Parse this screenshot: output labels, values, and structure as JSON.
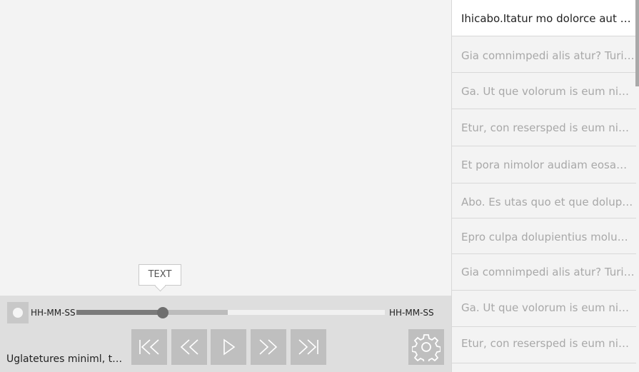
{
  "player": {
    "tooltip": "TEXT",
    "time_start": "HH-MM-SS",
    "time_end": "HH-MM-SS",
    "progress": {
      "played": 0.28,
      "buffered": 0.49
    },
    "caption": "Uglatetures miniml, tempo"
  },
  "controls": [
    {
      "name": "skip-to-start",
      "icon": "skip-start-icon"
    },
    {
      "name": "rewind",
      "icon": "rewind-icon"
    },
    {
      "name": "play",
      "icon": "play-icon"
    },
    {
      "name": "fast-forward",
      "icon": "fast-forward-icon"
    },
    {
      "name": "skip-to-end",
      "icon": "skip-end-icon"
    }
  ],
  "settings": {
    "icon": "gear-icon"
  },
  "playlist": {
    "items": [
      {
        "label": "Ihicabo.Itatur mo dolorce aut quam",
        "active": true
      },
      {
        "label": "Gia comnimpedi alis atur? Turibus",
        "active": false
      },
      {
        "label": "Ga. Ut que volorum is eum niatus",
        "active": false
      },
      {
        "label": "Etur, con resersped is eum niatus",
        "active": false
      },
      {
        "label": "Et pora nimolor audiam eosam que",
        "active": false
      },
      {
        "label": "Abo. Es utas quo et que dolupitis",
        "active": false
      },
      {
        "label": "Epro culpa dolupientius molumque",
        "active": false
      },
      {
        "label": "Gia comnimpedi alis atur? Turibus",
        "active": false
      },
      {
        "label": "Ga. Ut que volorum is eum niatus",
        "active": false
      },
      {
        "label": "Etur, con resersped is eum niatus",
        "active": false
      }
    ]
  }
}
